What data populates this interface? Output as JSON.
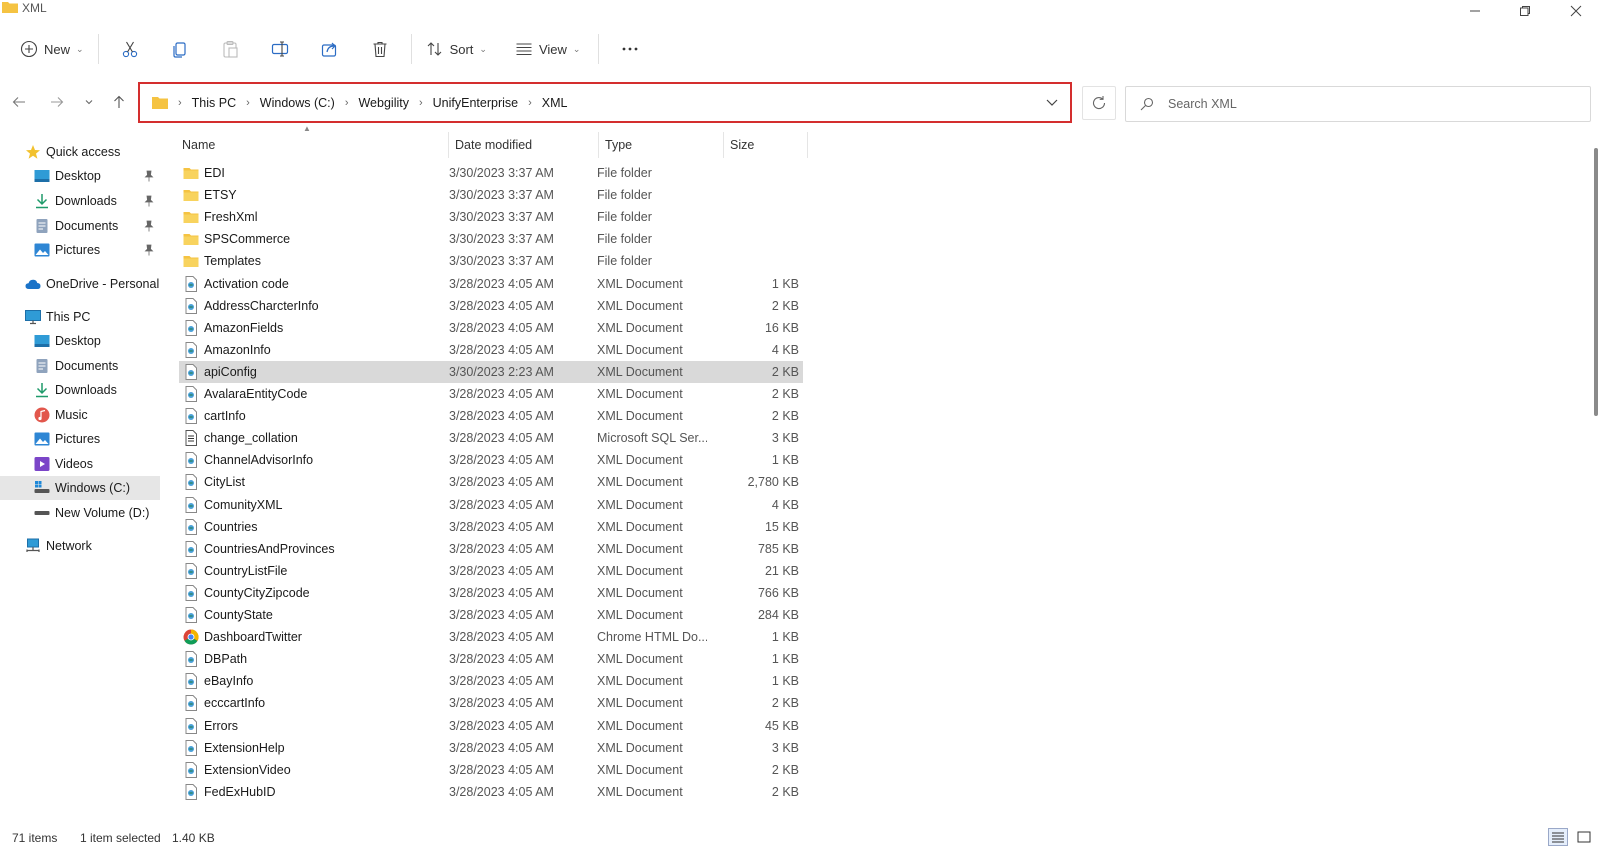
{
  "window": {
    "title": "XML"
  },
  "toolbar": {
    "new_label": "New",
    "sort_label": "Sort",
    "view_label": "View"
  },
  "address": {
    "crumbs": [
      "This PC",
      "Windows (C:)",
      "Webgility",
      "UnifyEnterprise",
      "XML"
    ]
  },
  "search": {
    "placeholder": "Search XML"
  },
  "sidebar": {
    "quick_access": "Quick access",
    "qa_items": [
      "Desktop",
      "Downloads",
      "Documents",
      "Pictures"
    ],
    "onedrive": "OneDrive - Personal",
    "this_pc": "This PC",
    "pc_items": [
      "Desktop",
      "Documents",
      "Downloads",
      "Music",
      "Pictures",
      "Videos",
      "Windows (C:)",
      "New Volume (D:)"
    ],
    "network": "Network"
  },
  "columns": {
    "name": "Name",
    "date": "Date modified",
    "type": "Type",
    "size": "Size"
  },
  "files": [
    {
      "name": "EDI",
      "date": "3/30/2023 3:37 AM",
      "type": "File folder",
      "size": "",
      "icon": "folder-icon"
    },
    {
      "name": "ETSY",
      "date": "3/30/2023 3:37 AM",
      "type": "File folder",
      "size": "",
      "icon": "folder-icon"
    },
    {
      "name": "FreshXml",
      "date": "3/30/2023 3:37 AM",
      "type": "File folder",
      "size": "",
      "icon": "folder-icon"
    },
    {
      "name": "SPSCommerce",
      "date": "3/30/2023 3:37 AM",
      "type": "File folder",
      "size": "",
      "icon": "folder-icon"
    },
    {
      "name": "Templates",
      "date": "3/30/2023 3:37 AM",
      "type": "File folder",
      "size": "",
      "icon": "folder-icon"
    },
    {
      "name": "Activation code",
      "date": "3/28/2023 4:05 AM",
      "type": "XML Document",
      "size": "1 KB",
      "icon": "xml-file-icon"
    },
    {
      "name": "AddressCharcterInfo",
      "date": "3/28/2023 4:05 AM",
      "type": "XML Document",
      "size": "2 KB",
      "icon": "xml-file-icon"
    },
    {
      "name": "AmazonFields",
      "date": "3/28/2023 4:05 AM",
      "type": "XML Document",
      "size": "16 KB",
      "icon": "xml-file-icon"
    },
    {
      "name": "AmazonInfo",
      "date": "3/28/2023 4:05 AM",
      "type": "XML Document",
      "size": "4 KB",
      "icon": "xml-file-icon"
    },
    {
      "name": "apiConfig",
      "date": "3/30/2023 2:23 AM",
      "type": "XML Document",
      "size": "2 KB",
      "icon": "xml-file-icon",
      "selected": true
    },
    {
      "name": "AvalaraEntityCode",
      "date": "3/28/2023 4:05 AM",
      "type": "XML Document",
      "size": "2 KB",
      "icon": "xml-file-icon"
    },
    {
      "name": "cartInfo",
      "date": "3/28/2023 4:05 AM",
      "type": "XML Document",
      "size": "2 KB",
      "icon": "xml-file-icon"
    },
    {
      "name": "change_collation",
      "date": "3/28/2023 4:05 AM",
      "type": "Microsoft SQL Ser...",
      "size": "3 KB",
      "icon": "sql-file-icon"
    },
    {
      "name": "ChannelAdvisorInfo",
      "date": "3/28/2023 4:05 AM",
      "type": "XML Document",
      "size": "1 KB",
      "icon": "xml-file-icon"
    },
    {
      "name": "CityList",
      "date": "3/28/2023 4:05 AM",
      "type": "XML Document",
      "size": "2,780 KB",
      "icon": "xml-file-icon"
    },
    {
      "name": "ComunityXML",
      "date": "3/28/2023 4:05 AM",
      "type": "XML Document",
      "size": "4 KB",
      "icon": "xml-file-icon"
    },
    {
      "name": "Countries",
      "date": "3/28/2023 4:05 AM",
      "type": "XML Document",
      "size": "15 KB",
      "icon": "xml-file-icon"
    },
    {
      "name": "CountriesAndProvinces",
      "date": "3/28/2023 4:05 AM",
      "type": "XML Document",
      "size": "785 KB",
      "icon": "xml-file-icon"
    },
    {
      "name": "CountryListFile",
      "date": "3/28/2023 4:05 AM",
      "type": "XML Document",
      "size": "21 KB",
      "icon": "xml-file-icon"
    },
    {
      "name": "CountyCityZipcode",
      "date": "3/28/2023 4:05 AM",
      "type": "XML Document",
      "size": "766 KB",
      "icon": "xml-file-icon"
    },
    {
      "name": "CountyState",
      "date": "3/28/2023 4:05 AM",
      "type": "XML Document",
      "size": "284 KB",
      "icon": "xml-file-icon"
    },
    {
      "name": "DashboardTwitter",
      "date": "3/28/2023 4:05 AM",
      "type": "Chrome HTML Do...",
      "size": "1 KB",
      "icon": "chrome-file-icon"
    },
    {
      "name": "DBPath",
      "date": "3/28/2023 4:05 AM",
      "type": "XML Document",
      "size": "1 KB",
      "icon": "xml-file-icon"
    },
    {
      "name": "eBayInfo",
      "date": "3/28/2023 4:05 AM",
      "type": "XML Document",
      "size": "1 KB",
      "icon": "xml-file-icon"
    },
    {
      "name": "ecccartInfo",
      "date": "3/28/2023 4:05 AM",
      "type": "XML Document",
      "size": "2 KB",
      "icon": "xml-file-icon"
    },
    {
      "name": "Errors",
      "date": "3/28/2023 4:05 AM",
      "type": "XML Document",
      "size": "45 KB",
      "icon": "xml-file-icon"
    },
    {
      "name": "ExtensionHelp",
      "date": "3/28/2023 4:05 AM",
      "type": "XML Document",
      "size": "3 KB",
      "icon": "xml-file-icon"
    },
    {
      "name": "ExtensionVideo",
      "date": "3/28/2023 4:05 AM",
      "type": "XML Document",
      "size": "2 KB",
      "icon": "xml-file-icon"
    },
    {
      "name": "FedExHubID",
      "date": "3/28/2023 4:05 AM",
      "type": "XML Document",
      "size": "2 KB",
      "icon": "xml-file-icon"
    }
  ],
  "status": {
    "count": "71 items",
    "selection": "1 item selected",
    "size": "1.40 KB"
  },
  "colors": {
    "selected_row": "#d9d9d9",
    "address_highlight": "#d42e2e",
    "folder": "#f5c342",
    "nav_selected": "#e6e6e6"
  }
}
